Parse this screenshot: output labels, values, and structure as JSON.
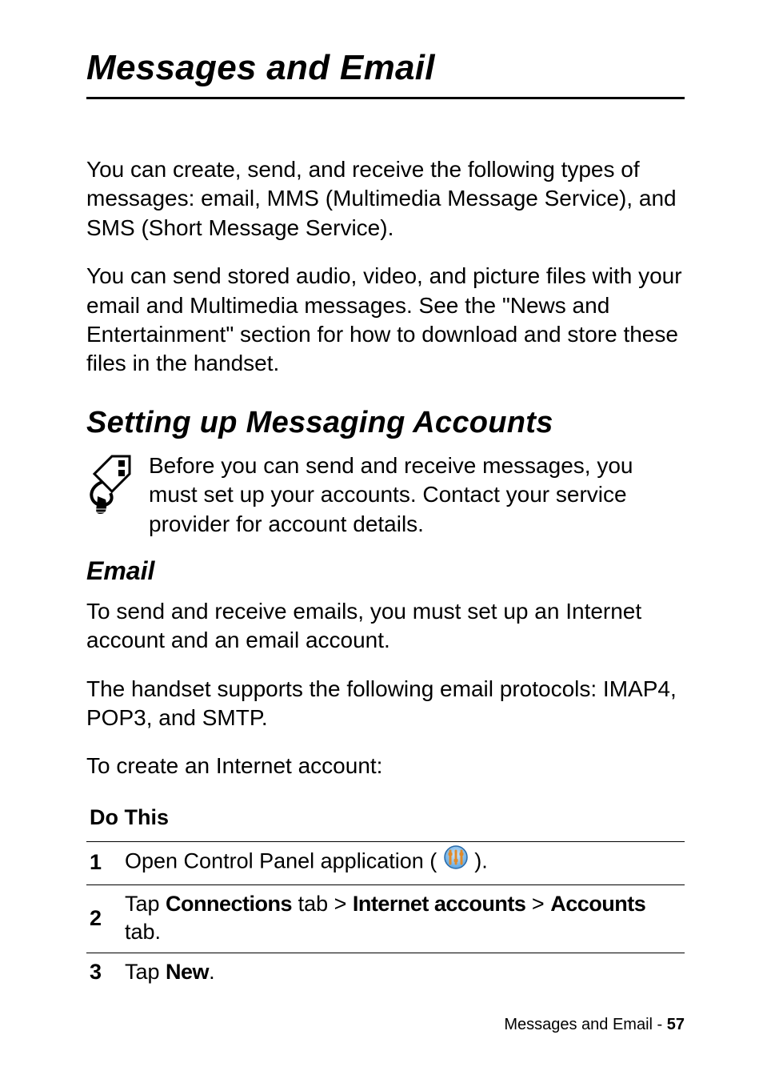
{
  "chapter_title": "Messages and Email",
  "para1": "You can create, send, and receive the following types of messages: email, MMS (Multimedia Message Service), and SMS (Short Message Service).",
  "para2": "You can send stored audio, video, and picture files with your email and Multimedia messages. See the \"News and Entertainment\" section for how to download and store these files in the handset.",
  "section1_title": "Setting up Messaging Accounts",
  "note1": "Before you can send and receive messages, you must set up your accounts. Contact your service provider for account details.",
  "email_title": "Email",
  "email_p1": "To send and receive emails, you must set up an Internet account and an email account.",
  "email_p2": "The handset supports the following email protocols: IMAP4, POP3, and SMTP.",
  "email_p3": "To create an Internet account:",
  "steps_header": "Do This",
  "steps": {
    "s1": {
      "num": "1",
      "pre": "Open Control Panel application ( ",
      "post": " )."
    },
    "s2": {
      "num": "2",
      "t_tap": "Tap ",
      "t_conn": "Connections",
      "t_tab1": " tab > ",
      "t_ia": "Internet accounts",
      "t_gt": " > ",
      "t_acc": "Accounts",
      "t_tab2": " tab."
    },
    "s3": {
      "num": "3",
      "t_tap": "Tap ",
      "t_new": "New",
      "t_period": "."
    }
  },
  "footer_label": "Messages and Email - ",
  "footer_page": "57"
}
